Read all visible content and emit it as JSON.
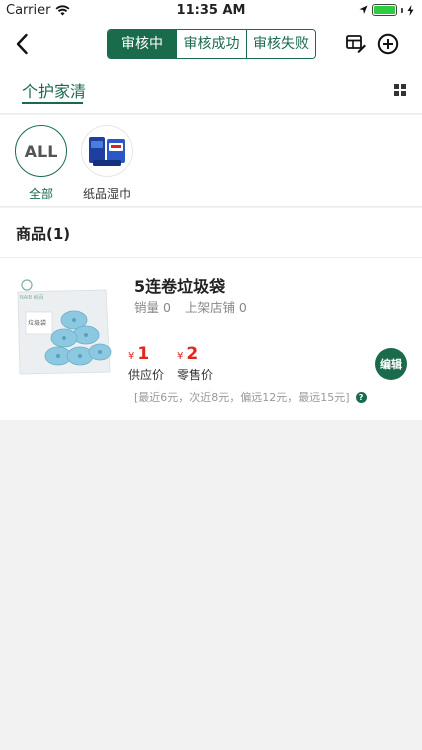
{
  "status_bar": {
    "carrier": "Carrier",
    "time": "11:35 AM"
  },
  "nav": {
    "segments": [
      {
        "label": "审核中",
        "active": true
      },
      {
        "label": "审核成功",
        "active": false
      },
      {
        "label": "审核失败",
        "active": false
      }
    ]
  },
  "category": {
    "active_tab": "个护家清"
  },
  "subcategories": [
    {
      "label": "全部",
      "badge": "ALL"
    },
    {
      "label": "纸品湿巾"
    }
  ],
  "section": {
    "title": "商品(1)"
  },
  "product": {
    "name": "5连卷垃圾袋",
    "sales": "销量 0",
    "stores": "上架店铺 0",
    "currency": "¥",
    "supply_price": "1",
    "supply_label": "供应价",
    "retail_price": "2",
    "retail_label": "零售价",
    "edit_label": "编辑",
    "price_hint": "[最近6元，次近8元，偏远12元，最远15元]",
    "help_glyph": "?",
    "pkg_brand": "NAIB 纳百",
    "pkg_label": "垃圾袋"
  },
  "colors": {
    "accent": "#1a6b4c",
    "price": "#e2261c"
  }
}
